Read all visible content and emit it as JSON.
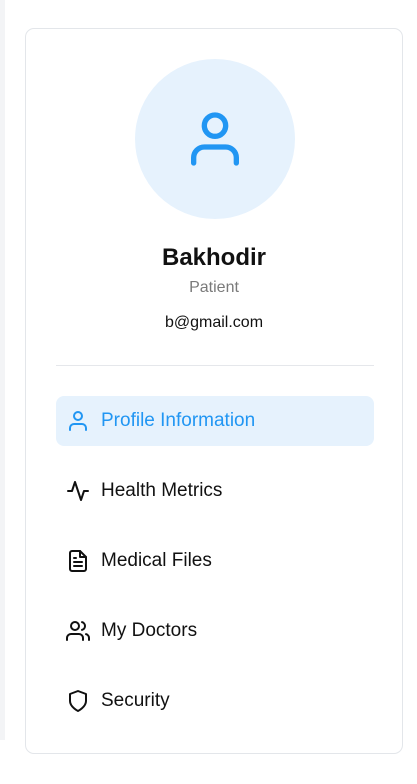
{
  "profile": {
    "name": "Bakhodir",
    "role": "Patient",
    "email": "b@gmail.com"
  },
  "nav": {
    "items": [
      {
        "label": "Profile Information",
        "icon": "user-icon",
        "active": true
      },
      {
        "label": "Health Metrics",
        "icon": "activity-icon",
        "active": false
      },
      {
        "label": "Medical Files",
        "icon": "file-text-icon",
        "active": false
      },
      {
        "label": "My Doctors",
        "icon": "users-icon",
        "active": false
      },
      {
        "label": "Security",
        "icon": "shield-icon",
        "active": false
      }
    ]
  },
  "colors": {
    "accent": "#2196f3",
    "accent_bg": "#e6f2fd",
    "text": "#111111",
    "muted": "#7a7a7a"
  }
}
